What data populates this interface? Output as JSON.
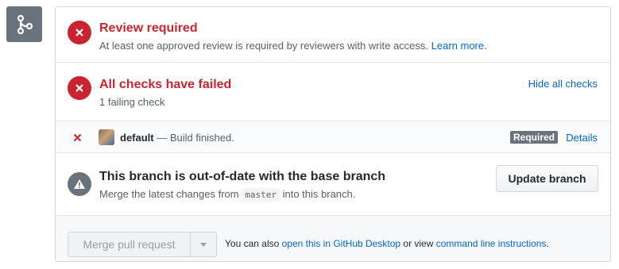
{
  "review": {
    "title": "Review required",
    "desc": "At least one approved review is required by reviewers with write access.",
    "learn_more": "Learn more."
  },
  "checks": {
    "title": "All checks have failed",
    "desc": "1 failing check",
    "hide_all": "Hide all checks",
    "items": [
      {
        "name": "default",
        "status": "— Build finished.",
        "badge": "Required",
        "details": "Details"
      }
    ]
  },
  "branch": {
    "title": "This branch is out-of-date with the base branch",
    "desc_before": "Merge the latest changes from",
    "base_branch": "master",
    "desc_after": "into this branch.",
    "update_button": "Update branch"
  },
  "merge": {
    "button": "Merge pull request",
    "note_before": "You can also",
    "desktop_link": "open this in GitHub Desktop",
    "note_mid": "or view",
    "cli_link": "command line instructions",
    "note_end": "."
  },
  "colors": {
    "error": "#cb2431",
    "link": "#0366d6",
    "neutral": "#6a737d"
  },
  "icons": [
    "git-merge-icon",
    "x-circle-icon",
    "x-icon",
    "alert-icon",
    "triangle-down-icon"
  ]
}
